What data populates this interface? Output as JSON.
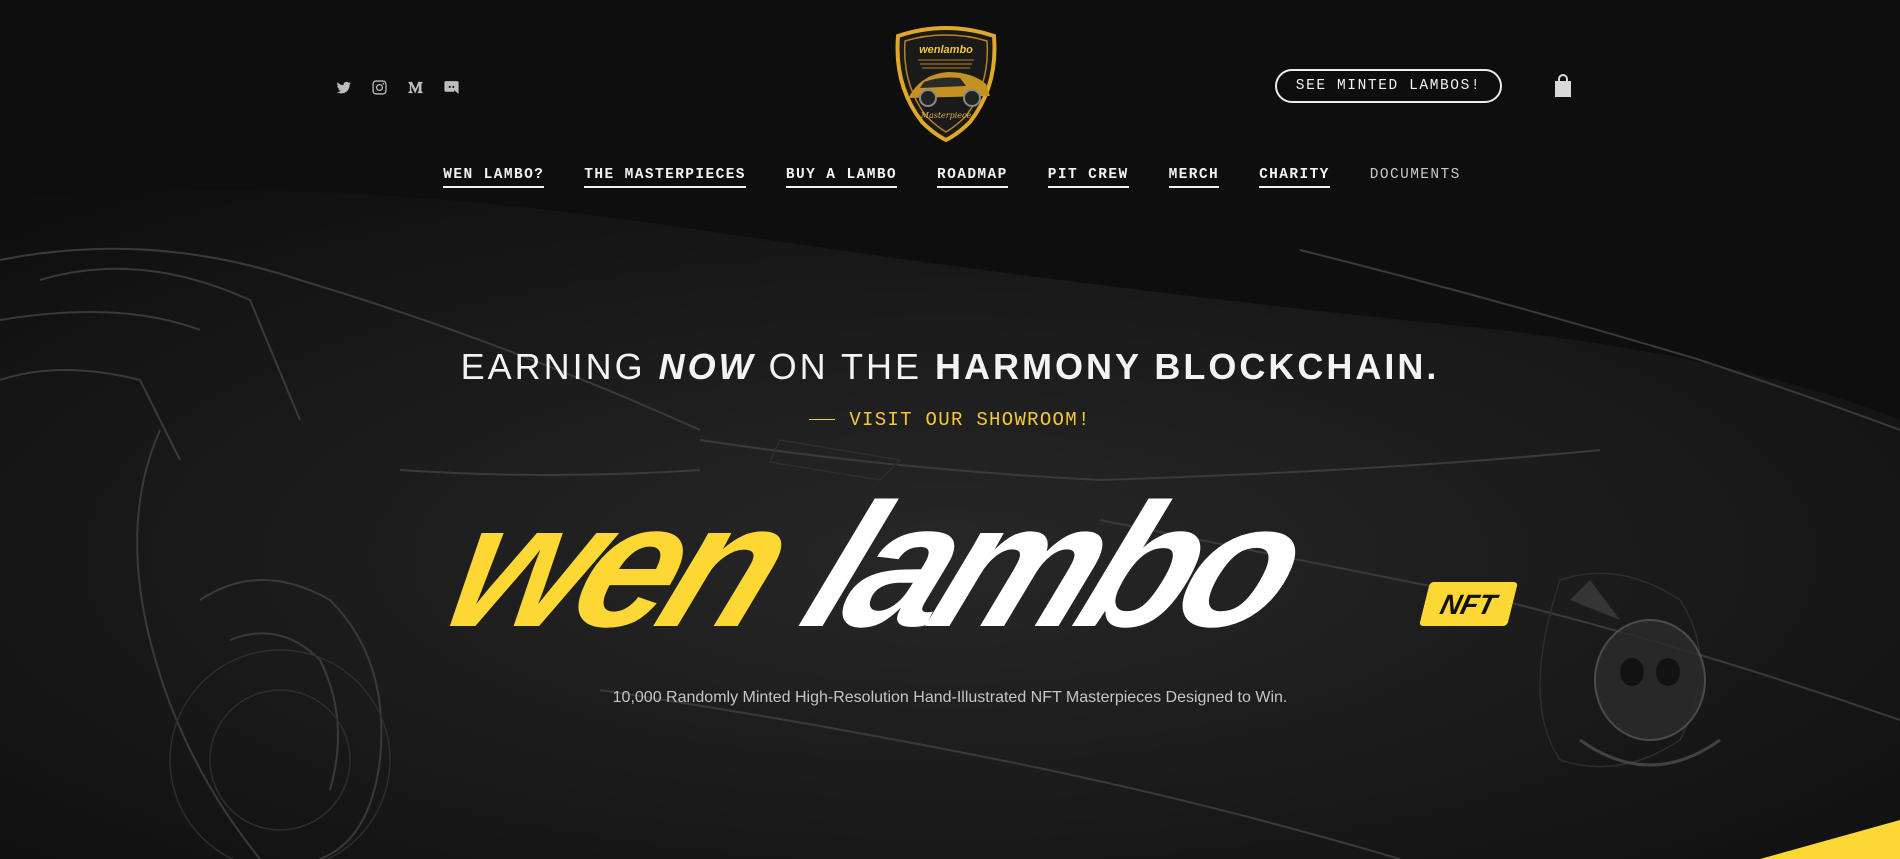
{
  "social": [
    {
      "name": "twitter-icon"
    },
    {
      "name": "instagram-icon"
    },
    {
      "name": "medium-icon"
    },
    {
      "name": "discord-icon"
    }
  ],
  "logo": {
    "top_text": "wenlambo",
    "bottom_text": "Masterpiece"
  },
  "header": {
    "cta_label": "SEE MINTED LAMBOS!"
  },
  "nav": [
    {
      "label": "WEN LAMBO?"
    },
    {
      "label": "THE MASTERPIECES"
    },
    {
      "label": "BUY A LAMBO"
    },
    {
      "label": "ROADMAP"
    },
    {
      "label": "PIT CREW"
    },
    {
      "label": "MERCH"
    },
    {
      "label": "CHARITY"
    },
    {
      "label": "DOCUMENTS"
    }
  ],
  "hero": {
    "headline_1": "EARNING ",
    "headline_2": "NOW",
    "headline_3": " ON THE ",
    "headline_4": "HARMONY BLOCKCHAIN.",
    "showroom": "VISIT OUR SHOWROOM!",
    "title_part1": "wen",
    "title_part2": "lambo",
    "title_badge": "NFT",
    "tagline": "10,000 Randomly Minted High-Resolution Hand-Illustrated NFT Masterpieces Designed to Win."
  },
  "colors": {
    "accent": "#fdd835",
    "background": "#0e0e0e",
    "text": "#f2f2f2"
  }
}
